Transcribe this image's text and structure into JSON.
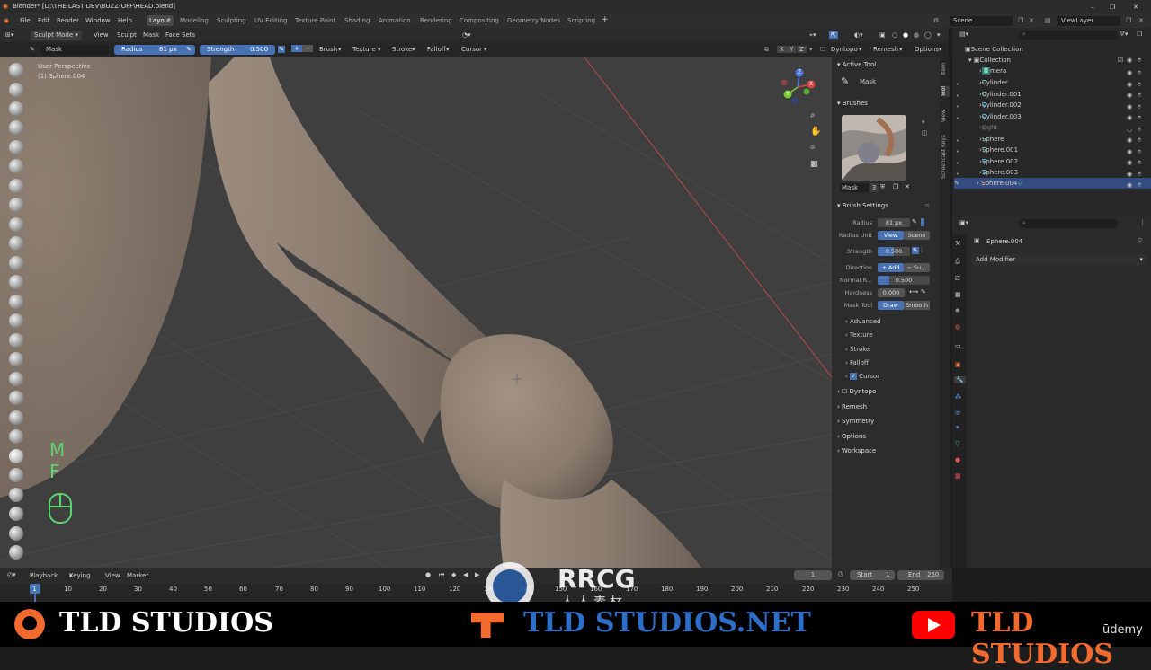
{
  "title_bar": {
    "title": "Blender* [D:\\THE LAST DEV\\BUZZ-OFF\\HEAD.blend]"
  },
  "menu": {
    "items": [
      "File",
      "Edit",
      "Render",
      "Window",
      "Help"
    ],
    "workspaces": [
      "Layout",
      "Modeling",
      "Sculpting",
      "UV Editing",
      "Texture Paint",
      "Shading",
      "Animation",
      "Rendering",
      "Compositing",
      "Geometry Nodes",
      "Scripting"
    ],
    "add_tab": "+",
    "scene_label": "Scene",
    "viewlayer_label": "ViewLayer"
  },
  "viewport_header": {
    "mode": "Sculpt Mode",
    "items": [
      "View",
      "Sculpt",
      "Mask",
      "Face Sets"
    ]
  },
  "tool_header": {
    "tool_name": "Mask",
    "radius_label": "Radius",
    "radius_value": "81 px",
    "strength_label": "Strength",
    "strength_value": "0.500",
    "plus": "+",
    "minus": "−",
    "dropdowns": [
      "Brush",
      "Texture",
      "Stroke",
      "Falloff",
      "Cursor"
    ],
    "axes": [
      "X",
      "Y",
      "Z"
    ],
    "right_dropdowns": [
      "Dyntopo",
      "Remesh",
      "Options"
    ]
  },
  "viewport": {
    "perspective_label": "User Perspective",
    "object_label": "(1) Sphere.004",
    "key_overlay": [
      "M",
      "F"
    ],
    "gizmo_axes": [
      "X",
      "Y",
      "Z"
    ]
  },
  "n_panel": {
    "tabs": [
      "Item",
      "Tool",
      "View",
      "Screencast Keys"
    ],
    "active_tool_header": "Active Tool",
    "active_tool_name": "Mask",
    "brushes_header": "Brushes",
    "brush_name": "Mask",
    "brush_users": "3",
    "brush_settings_header": "Brush Settings",
    "radius_label": "Radius",
    "radius_value": "81 px",
    "radius_unit_label": "Radius Unit",
    "radius_unit_view": "View",
    "radius_unit_scene": "Scene",
    "strength_label": "Strength",
    "strength_value": "0.500",
    "direction_label": "Direction",
    "direction_add": "+ Add",
    "direction_sub": "− Su...",
    "normal_radius_label": "Normal R...",
    "normal_radius_value": "0.500",
    "hardness_label": "Hardness",
    "hardness_value": "0.000",
    "mask_tool_label": "Mask Tool",
    "mask_tool_draw": "Draw",
    "mask_tool_smooth": "Smooth",
    "subpanels": [
      "Advanced",
      "Texture",
      "Stroke",
      "Falloff",
      "Cursor"
    ],
    "sections": [
      "Dyntopo",
      "Remesh",
      "Symmetry",
      "Options",
      "Workspace"
    ]
  },
  "outliner": {
    "root": "Scene Collection",
    "collection": "Collection",
    "objects": [
      "Camera",
      "Cylinder",
      "Cylinder.001",
      "Cylinder.002",
      "Cylinder.003",
      "Light",
      "Sphere",
      "Sphere.001",
      "Sphere.002",
      "Sphere.003",
      "Sphere.004"
    ],
    "selected": "Sphere.004"
  },
  "properties": {
    "object_name": "Sphere.004",
    "add_modifier": "Add Modifier"
  },
  "timeline": {
    "menus": [
      "Playback",
      "Keying",
      "View",
      "Marker"
    ],
    "current_frame": "1",
    "start_label": "Start",
    "start_value": "1",
    "end_label": "End",
    "end_value": "250",
    "ticks": [
      "1",
      "10",
      "20",
      "30",
      "40",
      "50",
      "60",
      "70",
      "80",
      "90",
      "100",
      "110",
      "120",
      "130",
      "140",
      "150",
      "160",
      "170",
      "180",
      "190",
      "200",
      "210",
      "220",
      "230",
      "240",
      "250"
    ]
  },
  "overlay": {
    "left_brand": "TLD STUDIOS",
    "center_brand": "TLD STUDIOS.NET",
    "right_brand": "TLD STUDIOS",
    "watermark_main": "RRCG",
    "watermark_sub": "人人素材",
    "udemy": "ūdemy"
  },
  "colors": {
    "accent_blue": "#4772b3",
    "selection": "#334d80",
    "viewport_bg": "#3f3f3f",
    "mesh": "#8c7d70",
    "key_overlay": "#5cd66f",
    "youtube_red": "#ff0000",
    "brand_orange": "#f26a2e"
  }
}
